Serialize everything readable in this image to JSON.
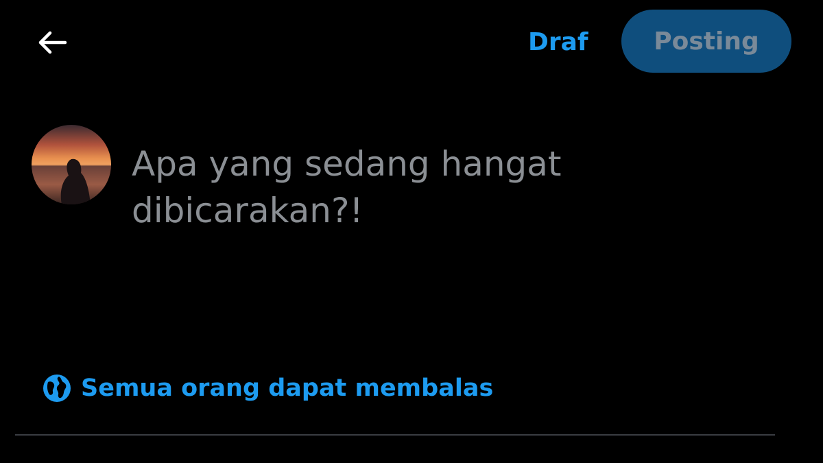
{
  "header": {
    "back_icon": "arrow-left-icon",
    "draft_label": "Draf",
    "post_label": "Posting"
  },
  "composer": {
    "avatar": "user-avatar",
    "placeholder": "Apa yang sedang hangat dibicarakan?!"
  },
  "reply_setting": {
    "icon": "globe-icon",
    "label": "Semua orang dapat membalas"
  },
  "colors": {
    "background": "#000000",
    "accent": "#1d9bf0",
    "post_button_bg": "#0f4e7d",
    "post_button_text": "#7a8a99",
    "placeholder_text": "#8b8f94",
    "divider": "#3a3d42"
  }
}
